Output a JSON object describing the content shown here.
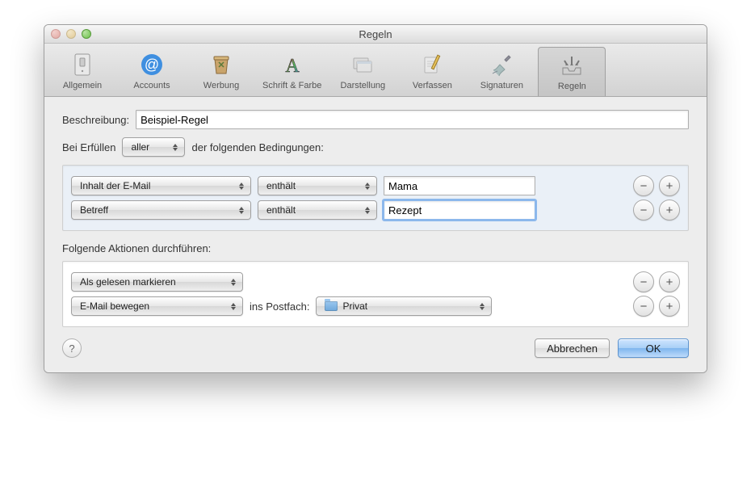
{
  "window": {
    "title": "Regeln"
  },
  "toolbar": {
    "items": [
      {
        "label": "Allgemein"
      },
      {
        "label": "Accounts"
      },
      {
        "label": "Werbung"
      },
      {
        "label": "Schrift & Farbe"
      },
      {
        "label": "Darstellung"
      },
      {
        "label": "Verfassen"
      },
      {
        "label": "Signaturen"
      },
      {
        "label": "Regeln"
      }
    ],
    "active_index": 7
  },
  "form": {
    "desc_label": "Beschreibung:",
    "desc_value": "Beispiel-Regel",
    "cond_prefix": "Bei Erfüllen",
    "cond_mode": "aller",
    "cond_suffix": "der folgenden Bedingungen:",
    "actions_label": "Folgende Aktionen durchführen:",
    "into_mailbox": "ins Postfach:"
  },
  "conditions": [
    {
      "field": "Inhalt der E-Mail",
      "op": "enthält",
      "value": "Mama",
      "focused": false
    },
    {
      "field": "Betreff",
      "op": "enthält",
      "value": "Rezept",
      "focused": true
    }
  ],
  "actions": [
    {
      "type": "Als gelesen markieren",
      "has_target": false
    },
    {
      "type": "E-Mail bewegen",
      "has_target": true,
      "target": "Privat"
    }
  ],
  "footer": {
    "cancel": "Abbrechen",
    "ok": "OK"
  }
}
